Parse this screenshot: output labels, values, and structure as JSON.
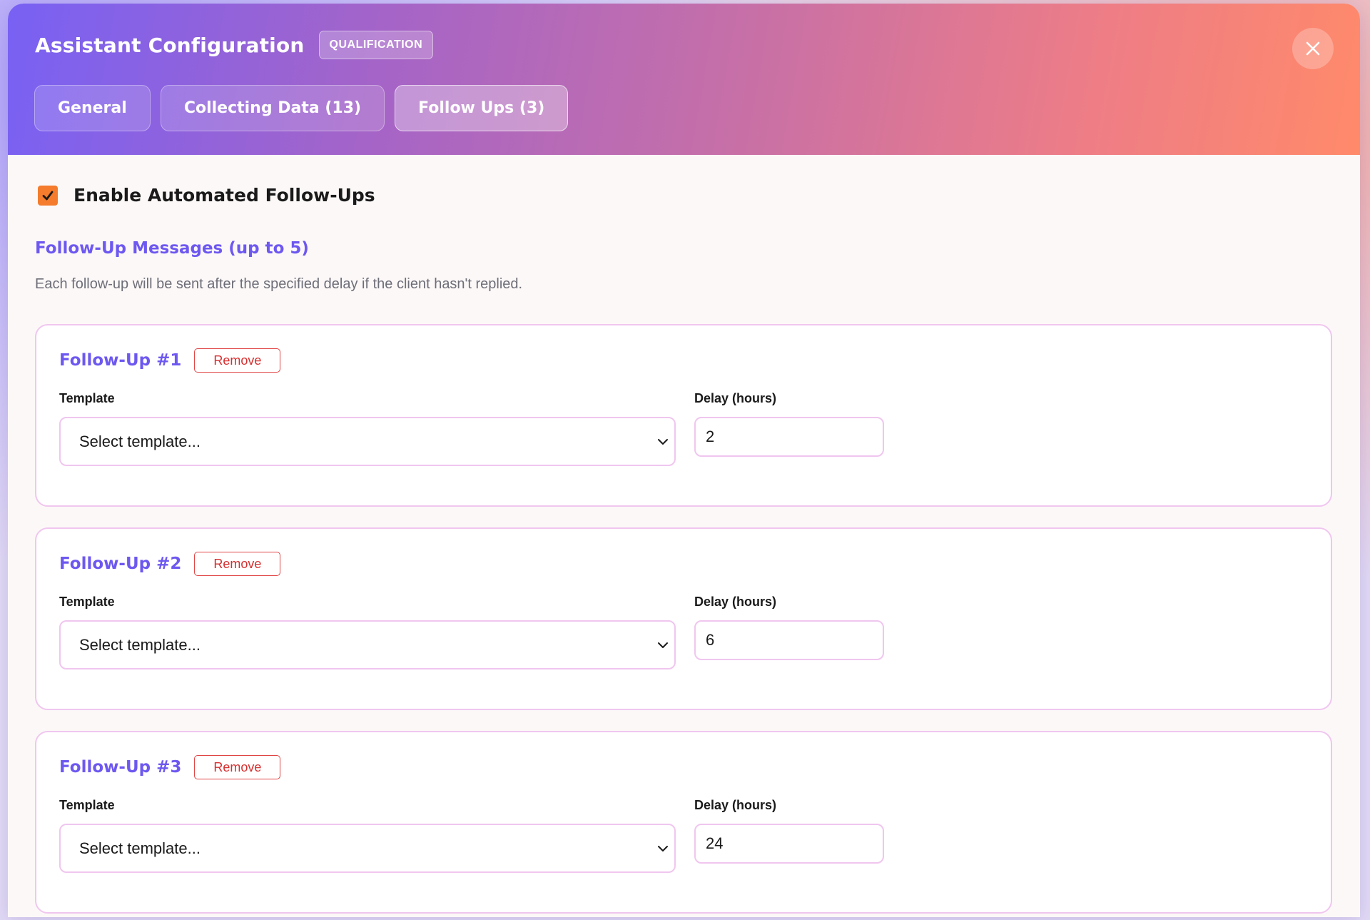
{
  "modal": {
    "title": "Assistant Configuration",
    "badge": "QUALIFICATION"
  },
  "tabs": [
    {
      "label": "General",
      "active": false
    },
    {
      "label": "Collecting Data (13)",
      "active": false
    },
    {
      "label": "Follow Ups (3)",
      "active": true
    }
  ],
  "followups": {
    "enable_label": "Enable Automated Follow-Ups",
    "enabled": true,
    "section_title": "Follow-Up Messages (up to 5)",
    "section_desc": "Each follow-up will be sent after the specified delay if the client hasn't replied.",
    "items": [
      {
        "title": "Follow-Up #1",
        "remove_label": "Remove",
        "template_label": "Template",
        "template_value": "Select template...",
        "delay_label": "Delay (hours)",
        "delay_value": "2"
      },
      {
        "title": "Follow-Up #2",
        "remove_label": "Remove",
        "template_label": "Template",
        "template_value": "Select template...",
        "delay_label": "Delay (hours)",
        "delay_value": "6"
      },
      {
        "title": "Follow-Up #3",
        "remove_label": "Remove",
        "template_label": "Template",
        "template_value": "Select template...",
        "delay_label": "Delay (hours)",
        "delay_value": "24"
      }
    ]
  },
  "icons": {
    "close": "close-icon",
    "check": "checkmark-icon",
    "dropdown": "chevron-down-icon"
  },
  "colors": {
    "accent_purple": "#6d58f0",
    "checkbox_orange": "#f47c2c",
    "remove_red": "#d62f2f",
    "card_border": "#f0c6ef"
  }
}
